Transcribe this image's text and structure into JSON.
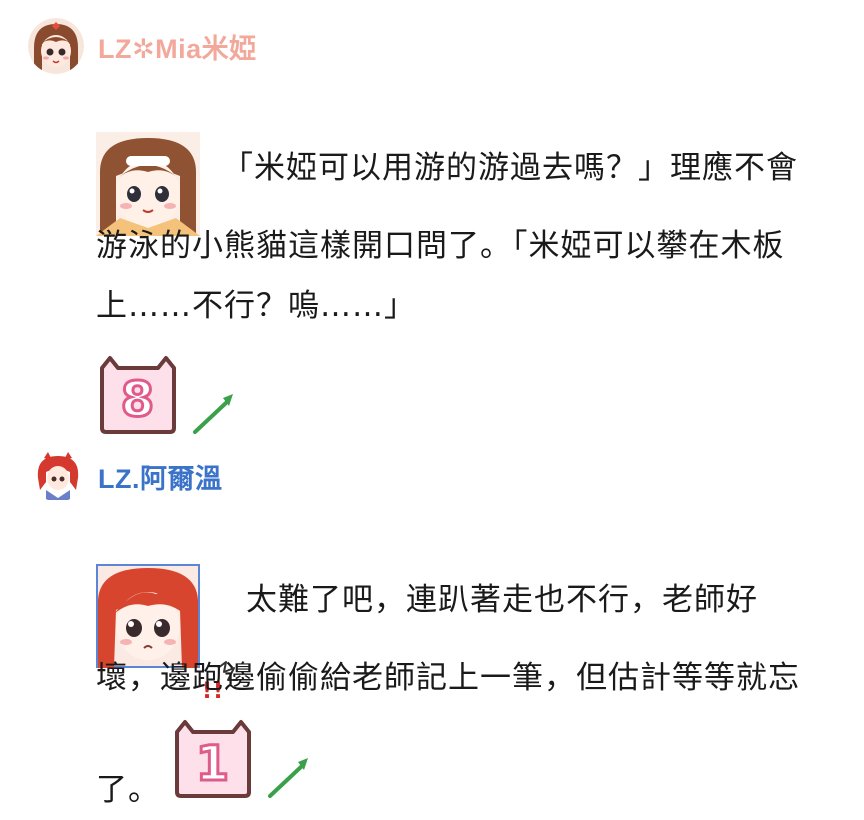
{
  "messages": [
    {
      "author": "LZ✲Mia米婭",
      "author_color": "#f2a89a",
      "lines": [
        "「米婭可以用游的游過去嗎？」理應不會",
        "游泳的小熊貓這樣開口問了。「米婭可以攀在木板",
        "上……不行？嗚……」"
      ],
      "dice_value": "8",
      "avatar_icon": "girl-brown-hair-avatar-icon",
      "sticker_icon": "girl-brown-hair-sticker-icon"
    },
    {
      "author": "LZ.阿爾溫",
      "author_color": "#3b73c9",
      "lines": [
        "太難了吧，連趴著走也不行，老師好",
        "壞，邊跑邊偷偷給老師記上一筆，但估計等等就忘",
        "了。"
      ],
      "dice_value": "1",
      "avatar_icon": "girl-red-hair-avatar-icon",
      "sticker_icon": "girl-red-hair-sticker-icon"
    }
  ]
}
